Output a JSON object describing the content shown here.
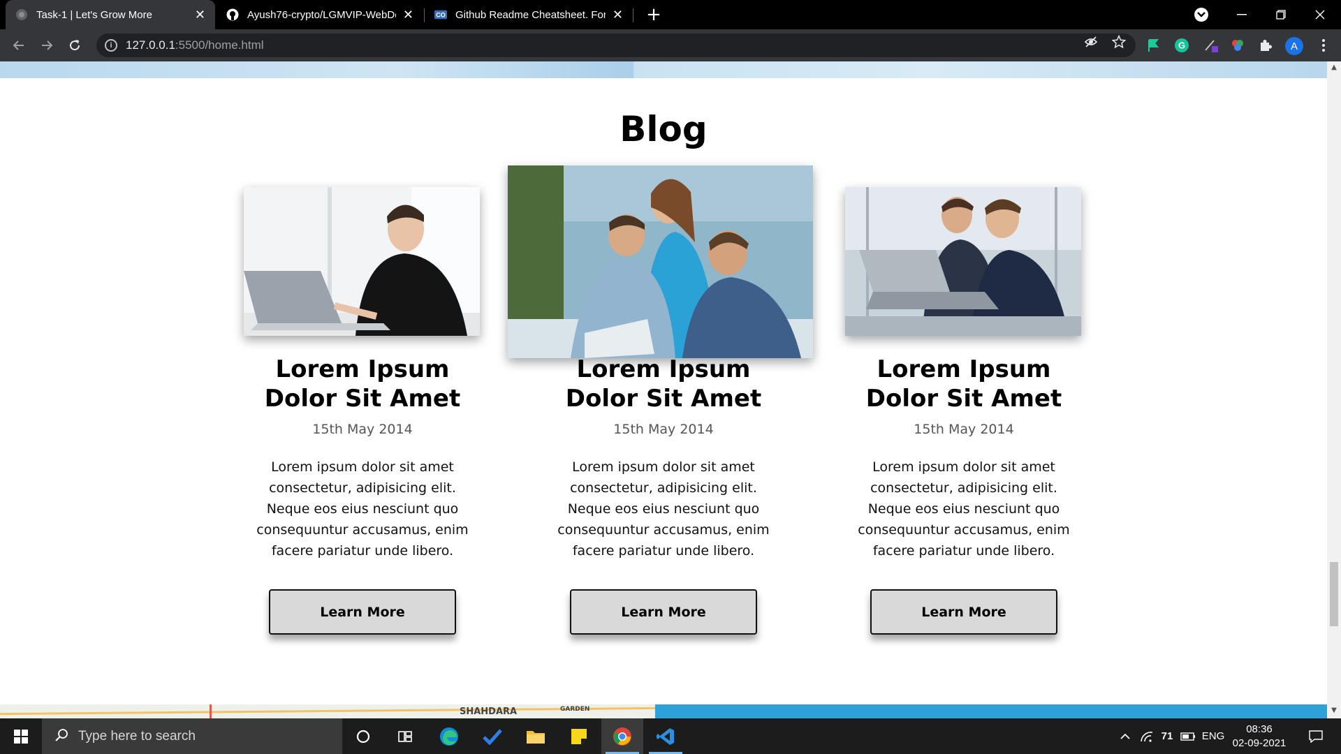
{
  "browser": {
    "tabs": [
      {
        "title": "Task-1 | Let's Grow More",
        "active": true,
        "favicon": "globe-icon"
      },
      {
        "title": "Ayush76-crypto/LGMVIP-WebDe",
        "active": false,
        "favicon": "github-icon"
      },
      {
        "title": "Github Readme Cheatsheet. For a",
        "active": false,
        "favicon": "co-icon"
      }
    ],
    "url_host": "127.0.0.1",
    "url_path": ":5500/home.html"
  },
  "page": {
    "section_title": "Blog",
    "cards": [
      {
        "title": "Lorem Ipsum Dolor Sit Amet",
        "date": "15th May 2014",
        "text": "Lorem ipsum dolor sit amet consectetur, adipisicing elit. Neque eos eius nesciunt quo consequuntur accusamus, enim facere pariatur unde libero.",
        "button": "Learn More",
        "image": "man-working-laptop"
      },
      {
        "title": "Lorem Ipsum Dolor Sit Amet",
        "date": "15th May 2014",
        "text": "Lorem ipsum dolor sit amet consectetur, adipisicing elit. Neque eos eius nesciunt quo consequuntur accusamus, enim facere pariatur unde libero.",
        "button": "Learn More",
        "image": "team-meeting-laptop"
      },
      {
        "title": "Lorem Ipsum Dolor Sit Amet",
        "date": "15th May 2014",
        "text": "Lorem ipsum dolor sit amet consectetur, adipisicing elit. Neque eos eius nesciunt quo consequuntur accusamus, enim facere pariatur unde libero.",
        "button": "Learn More",
        "image": "businessmen-laptop"
      }
    ],
    "map_labels": [
      "SHAHDARA",
      "GARDEN"
    ]
  },
  "taskbar": {
    "search_placeholder": "Type here to search",
    "tray": {
      "temperature": "71",
      "language": "ENG",
      "time": "08:36",
      "date": "02-09-2021"
    }
  },
  "colors": {
    "button_bg": "#d9d9d9",
    "bottom_blue": "#2ea1d8",
    "avatar": "#1a73e8"
  }
}
